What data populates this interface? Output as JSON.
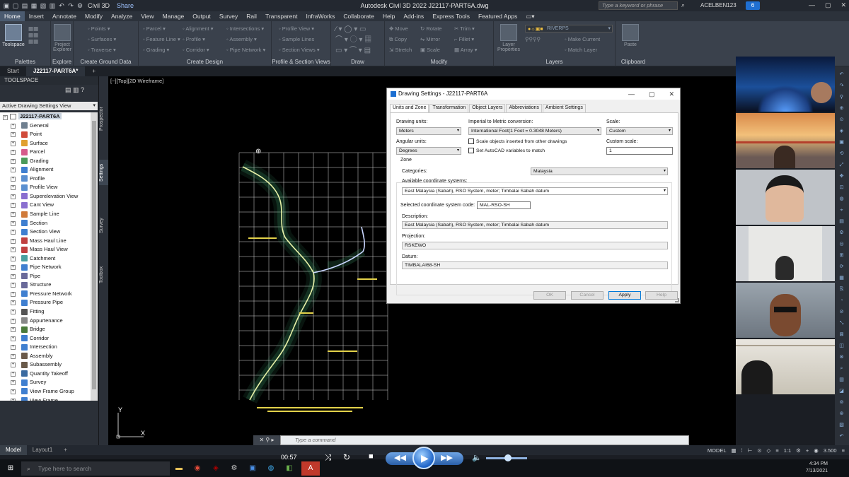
{
  "titlebar": {
    "workspace": "Civil 3D",
    "share": "Share",
    "app_title": "Autodesk Civil 3D 2022   J22117-PART6A.dwg",
    "search_placeholder": "Type a keyword or phrase",
    "user": "ACELBEN123",
    "notifications": "6"
  },
  "menu": [
    "Home",
    "Insert",
    "Annotate",
    "Modify",
    "Analyze",
    "View",
    "Manage",
    "Output",
    "Survey",
    "Rail",
    "Transparent",
    "InfraWorks",
    "Collaborate",
    "Help",
    "Add-ins",
    "Express Tools",
    "Featured Apps"
  ],
  "ribbon": {
    "panels": [
      {
        "title": "Palettes",
        "big": [
          "Toolspace"
        ]
      },
      {
        "title": "Explore",
        "big": [
          "Project Explorer"
        ]
      },
      {
        "title": "Create Ground Data",
        "rows": [
          "Points",
          "Surfaces",
          "Traverse"
        ]
      },
      {
        "title": "Create Design",
        "rows": [
          "Parcel",
          "Feature Line",
          "Grading",
          "Alignment",
          "Profile",
          "Corridor",
          "Intersections",
          "Assembly",
          "Pipe Network"
        ]
      },
      {
        "title": "Profile & Section Views",
        "rows": [
          "Profile View",
          "Sample Lines",
          "Section Views"
        ]
      },
      {
        "title": "Draw",
        "rows": [
          "",
          "",
          ""
        ]
      },
      {
        "title": "Modify",
        "rows": [
          "Move",
          "Copy",
          "Stretch",
          "Rotate",
          "Mirror",
          "Scale",
          "Trim",
          "Fillet",
          "Array"
        ]
      },
      {
        "title": "Layers",
        "big": [
          "Layer Properties"
        ],
        "rows": [
          "RIVERPS",
          "Make Current",
          "Match Layer"
        ]
      },
      {
        "title": "Clipboard",
        "big": [
          "Paste"
        ]
      }
    ]
  },
  "doctabs": [
    "Start",
    "J22117-PART6A*"
  ],
  "toolspace": {
    "title": "TOOLSPACE",
    "view": "Active Drawing Settings View",
    "root": "J22117-PART6A",
    "items": [
      "General",
      "Point",
      "Surface",
      "Parcel",
      "Grading",
      "Alignment",
      "Profile",
      "Profile View",
      "Superelevation View",
      "Cant View",
      "Sample Line",
      "Section",
      "Section View",
      "Mass Haul Line",
      "Mass Haul View",
      "Catchment",
      "Pipe Network",
      "Pipe",
      "Structure",
      "Pressure Network",
      "Pressure Pipe",
      "Fitting",
      "Appurtenance",
      "Bridge",
      "Corridor",
      "Intersection",
      "Assembly",
      "Subassembly",
      "Quantity Takeoff",
      "Survey",
      "View Frame Group",
      "View Frame"
    ],
    "side_tabs": [
      "Prospector",
      "Settings",
      "Survey",
      "Toolbox"
    ]
  },
  "viewport": {
    "label": "[−][Top][2D Wireframe]",
    "ucs_y": "Y",
    "ucs_x": "X"
  },
  "command_placeholder": "Type a command",
  "dialog": {
    "title": "Drawing Settings - J22117-PART6A",
    "tabs": [
      "Units and Zone",
      "Transformation",
      "Object Layers",
      "Abbreviations",
      "Ambient Settings"
    ],
    "active_tab": "Units and Zone",
    "drawing_units_label": "Drawing units:",
    "drawing_units": "Meters",
    "angular_units_label": "Angular units:",
    "angular_units": "Degrees",
    "conversion_label": "Imperial to Metric conversion:",
    "conversion": "International Foot(1 Foot = 0.3048 Meters)",
    "scale_objects": "Scale objects inserted from other drawings",
    "set_autocad_vars": "Set AutoCAD variables to match",
    "scale_label": "Scale:",
    "scale": "Custom",
    "custom_scale_label": "Custom scale:",
    "custom_scale": "1",
    "zone_label": "Zone",
    "categories_label": "Categories:",
    "categories": "Malaysia",
    "available_label": "Available coordinate systems:",
    "available": "East Malaysia (Sabah), RSO System, meter; Timbalai Sabah datum",
    "selected_code_label": "Selected coordinate system code:",
    "selected_code": "MAL-RSO-SH",
    "description_label": "Description:",
    "description": "East Malaysia (Sabah), RSO System, meter; Timbalai Sabah datum",
    "projection_label": "Projection:",
    "projection": "RSKEWO",
    "datum_label": "Datum:",
    "datum": "TIMBALAI68-SH",
    "buttons": {
      "ok": "OK",
      "cancel": "Cancel",
      "apply": "Apply",
      "help": "Help"
    }
  },
  "layout_tabs": [
    "Model",
    "Layout1"
  ],
  "status": {
    "model": "MODEL",
    "scale": "1:1",
    "value": "3.500"
  },
  "media": {
    "time": "00:57"
  },
  "taskbar": {
    "search_placeholder": "Type here to search",
    "time": "4:34 PM",
    "date": "7/13/2021"
  },
  "colors": {
    "accent": "#0078d7",
    "ribbon": "#3a414c",
    "viewport": "#000000",
    "drawing_line": "#e8f2a8",
    "contour": "#3f9a6a",
    "grid": "#ffffff"
  }
}
